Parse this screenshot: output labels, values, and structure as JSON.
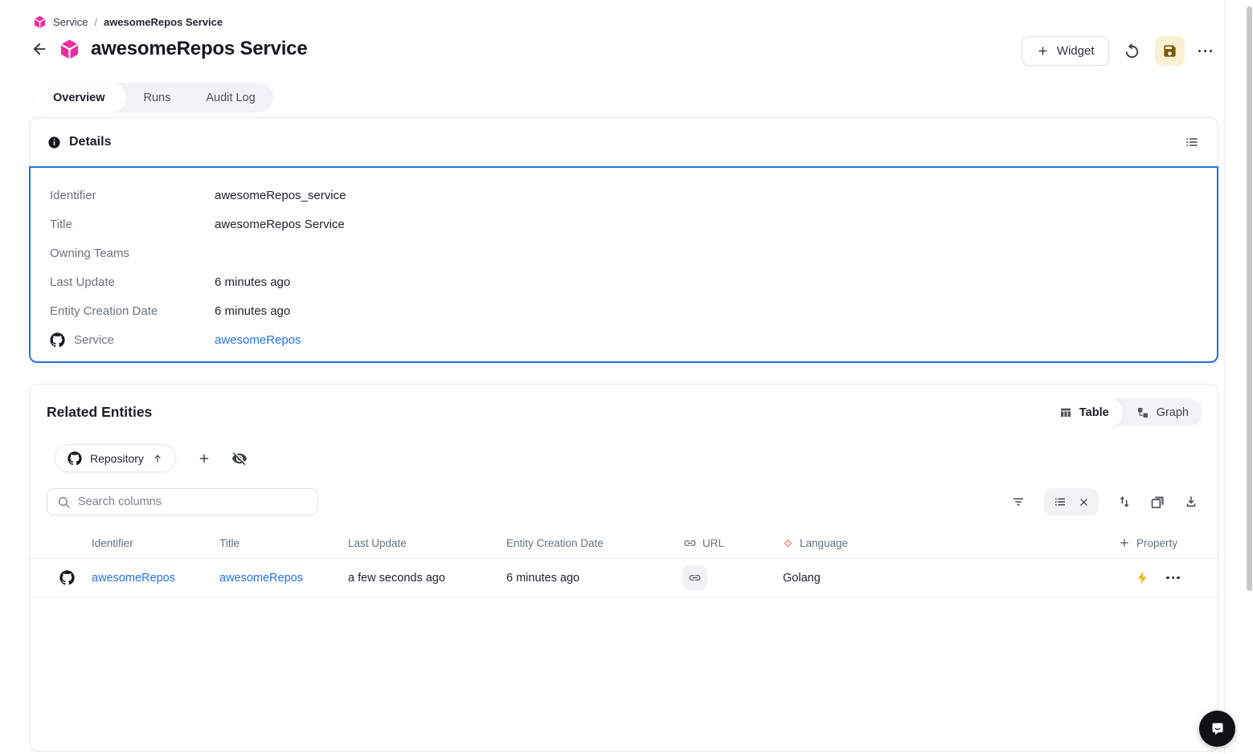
{
  "breadcrumb": {
    "items": [
      "Service",
      "awesomeRepos Service"
    ],
    "separator": "/"
  },
  "header": {
    "title": "awesomeRepos Service",
    "widget_label": "Widget"
  },
  "tabs": [
    {
      "label": "Overview",
      "active": true
    },
    {
      "label": "Runs",
      "active": false
    },
    {
      "label": "Audit Log",
      "active": false
    }
  ],
  "details": {
    "title": "Details",
    "fields": [
      {
        "label": "Identifier",
        "value": "awesomeRepos_service"
      },
      {
        "label": "Title",
        "value": "awesomeRepos Service"
      },
      {
        "label": "Owning Teams",
        "value": ""
      },
      {
        "label": "Last Update",
        "value": "6 minutes ago"
      },
      {
        "label": "Entity Creation Date",
        "value": "6 minutes ago"
      },
      {
        "label": "Service",
        "value": "awesomeRepos",
        "icon": "github-icon",
        "is_link": true
      }
    ]
  },
  "related": {
    "title": "Related Entities",
    "view_toggle": {
      "table_label": "Table",
      "graph_label": "Graph",
      "active": "Table"
    },
    "filter_pill_label": "Repository",
    "search_placeholder": "Search columns",
    "toolbar_icons": [
      "filter-icon",
      "view-list-icon",
      "clear-icon",
      "sort-icon",
      "copy-icon",
      "download-icon"
    ],
    "table": {
      "columns": [
        {
          "label": "Identifier"
        },
        {
          "label": "Title"
        },
        {
          "label": "Last Update"
        },
        {
          "label": "Entity Creation Date"
        },
        {
          "label": "URL",
          "icon": "link-icon"
        },
        {
          "label": "Language",
          "icon": "diamond-icon"
        }
      ],
      "add_property_label": "Property",
      "rows": [
        {
          "icon": "github-icon",
          "identifier": "awesomeRepos",
          "title": "awesomeRepos",
          "last_update": "a few seconds ago",
          "entity_creation_date": "6 minutes ago",
          "url_icon": "link-icon",
          "language": "Golang",
          "row_icons": [
            "bolt-icon",
            "more-icon"
          ]
        }
      ]
    }
  },
  "colors": {
    "accent_pink": "#EE2B9E",
    "link_blue": "#2273E8",
    "selection_border": "#2273E8",
    "save_button_bg": "#FAF0D3",
    "save_icon": "#7A5901",
    "bolt_amber": "#F6B50B",
    "diamond_coral": "#F2826F",
    "chat_bubble_bg": "#101114"
  }
}
